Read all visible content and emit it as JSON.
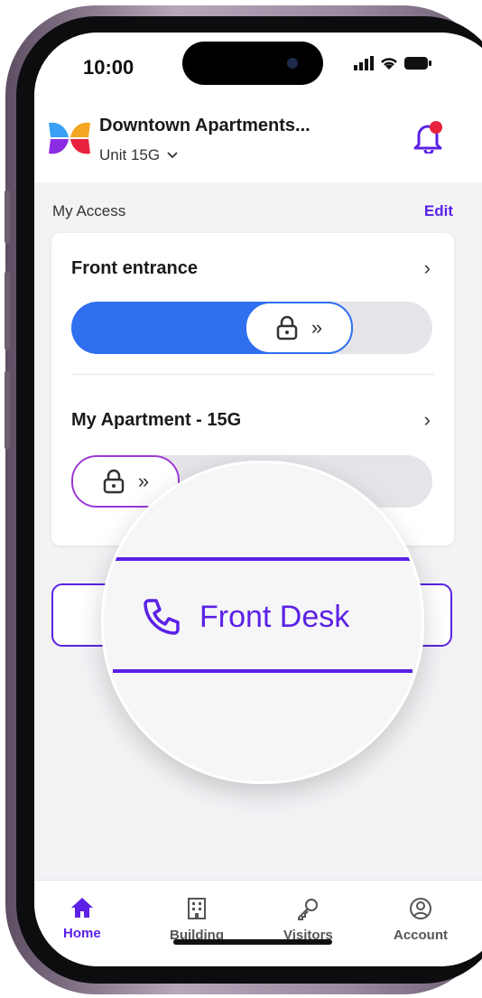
{
  "status": {
    "time": "10:00"
  },
  "header": {
    "title": "Downtown Apartments...",
    "unit": "Unit 15G",
    "notification_dot_color": "#e8223d"
  },
  "access": {
    "label": "My Access",
    "edit_label": "Edit",
    "items": [
      {
        "title": "Front entrance",
        "state": "unlocked",
        "slider_position": 0.55
      },
      {
        "title": "My Apartment - 15G",
        "state": "locked",
        "slider_position": 0.0
      }
    ]
  },
  "front_desk": {
    "label": "Front Desk"
  },
  "tabs": [
    {
      "label": "Home",
      "icon": "home-icon",
      "active": true
    },
    {
      "label": "Building",
      "icon": "building-icon",
      "active": false
    },
    {
      "label": "Visitors",
      "icon": "key-icon",
      "active": false
    },
    {
      "label": "Account",
      "icon": "account-icon",
      "active": false
    }
  ],
  "colors": {
    "accent": "#5b21e6",
    "slider_blue": "#2f6ff0",
    "locked_outline": "#9b3ad6"
  }
}
